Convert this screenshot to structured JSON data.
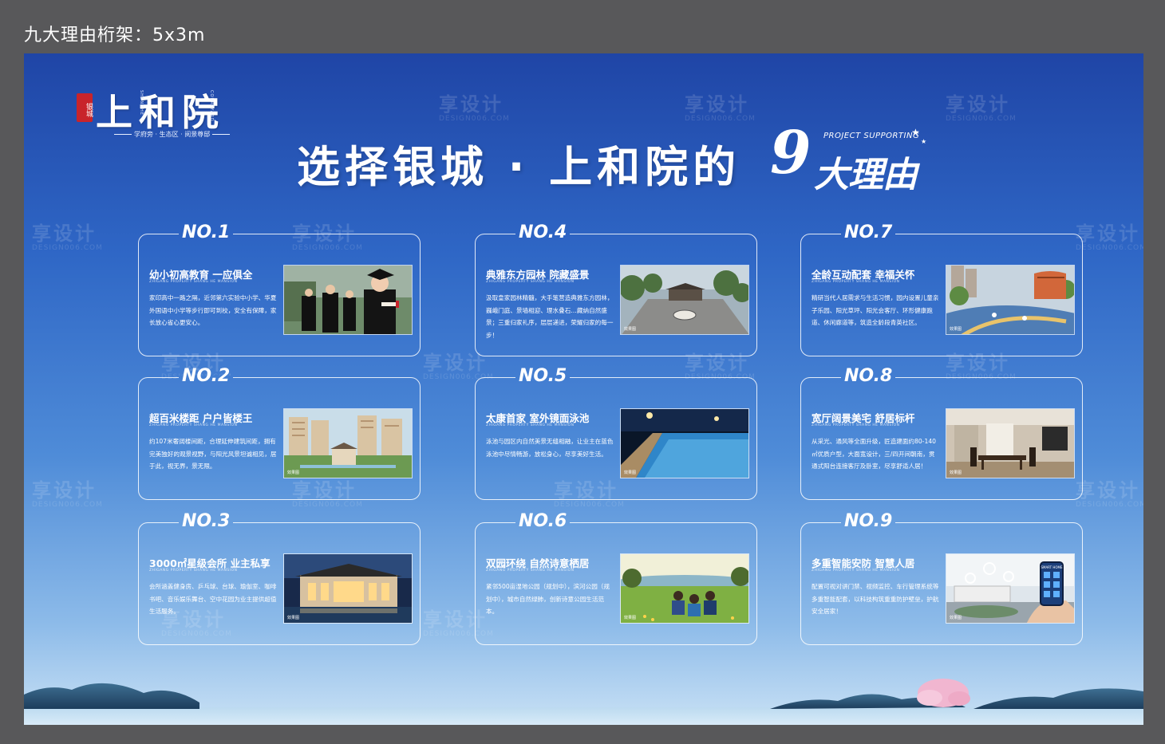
{
  "spec_label": "九大理由桁架：5x3m",
  "logo": {
    "seal": "银城",
    "name": "上和院",
    "vertical_left": "SHANGHE",
    "vertical_right": "COURTYARD",
    "tagline": "学府旁 · 生态区 · 阅景尊邸"
  },
  "headline": {
    "main": "选择银城 · 上和院的",
    "number": "9",
    "sub": "大理由",
    "en": "PROJECT SUPPORTING"
  },
  "watermark": {
    "cn": "享设计",
    "en": "DESIGN006.COM"
  },
  "cards": [
    {
      "no": "NO.1",
      "title": "幼小初高教育  一应俱全",
      "en": "ZHIGANG PROPERTY SHANG HE MANSION",
      "body": "家印高中一路之隔，近邻第六实验中小学、华夏外国语中小学等步行即可到校，安全有保障，家长放心省心更安心。",
      "photo": "graduates"
    },
    {
      "no": "NO.2",
      "title": "超百米楼距  户户皆楼王",
      "en": "ZHIGANG PROPERTY SHANG HE MANSION",
      "body": "约107米奢阔楼间距，合理延伸建筑间距，拥有完美独好的观景视野，与阳光风景坦诚相见，居于此，视无界，景无限。",
      "photo": "buildings",
      "photo_tag": "效果图"
    },
    {
      "no": "NO.3",
      "title": "3000㎡星级会所  业主私享",
      "en": "ZHIGANG PROPERTY SHANG HE MANSION",
      "body": "会所涵盖健身房、乒乓球、台球、瑜伽室、咖啡书吧、音乐娱乐舞台、空中花园为业主提供超值生活服务。",
      "photo": "clubhouse",
      "photo_tag": "效果图"
    },
    {
      "no": "NO.4",
      "title": "典雅东方园林  院藏盛景",
      "en": "ZHIGANG PROPERTY SHANG HE MANSION",
      "body": "汲取皇家园林精髓，大手笔营造典雅东方园林，巍峨门庭、景墙相迎、理水叠石…藏纳自然盛景；三重归家礼序，层层递进，荣耀归家的每一步！",
      "photo": "garden",
      "photo_tag": "效果图"
    },
    {
      "no": "NO.5",
      "title": "太康首家  室外镜面泳池",
      "en": "ZHIGANG PROPERTY SHANG HE MANSION",
      "body": "泳池与园区内自然美景无缝相融，让业主在蓝色泳池中尽情畅游，放松身心，尽享美好生活。",
      "photo": "pool",
      "photo_tag": "效果图"
    },
    {
      "no": "NO.6",
      "title": "双园环绕  自然诗意栖居",
      "en": "ZHIGANG PROPERTY SHANG HE MANSION",
      "body": "紧邻500亩湿地公园（规划中），滨河公园（规划中），城市自然绿肺，创新诗意公园生活范本。",
      "photo": "park",
      "photo_tag": "效果图"
    },
    {
      "no": "NO.7",
      "title": "全龄互动配套  幸福关怀",
      "en": "ZHIGANG PROPERTY SHANG HE MANSION",
      "body": "精研当代人居需求与生活习惯，园内设置儿童亲子乐园、阳光草坪、阳光会客厅、环形健康跑道、休闲廊道等，筑造全龄段青英社区。",
      "photo": "playground",
      "photo_tag": "效果图"
    },
    {
      "no": "NO.8",
      "title": "宽厅阔景美宅  舒居标杆",
      "en": "ZHIGANG PROPERTY SHANG HE MANSION",
      "body": "从采光、通风等全面升级，匠造建面约80-140㎡优质户型，大面宽设计，三/四开间朝南，贯通式阳台连接客厅及卧室，尽享舒适人居！",
      "photo": "interior",
      "photo_tag": "效果图"
    },
    {
      "no": "NO.9",
      "title": "多重智能安防  智慧人居",
      "en": "ZHIGANG PROPERTY SHANG HE MANSION",
      "body": "配置可视对讲门禁、视频监控、车行管理系统等多重智能配套，以科技构筑重重防护壁垒，护航安全居家！",
      "photo": "smarthome",
      "phone_text": "SMART HOME",
      "photo_tag": "效果图"
    }
  ],
  "colors": {
    "board_top": "#1f45a6",
    "board_bottom": "#c9e1f5",
    "frame": "#58585a",
    "seal": "#c8242b"
  }
}
